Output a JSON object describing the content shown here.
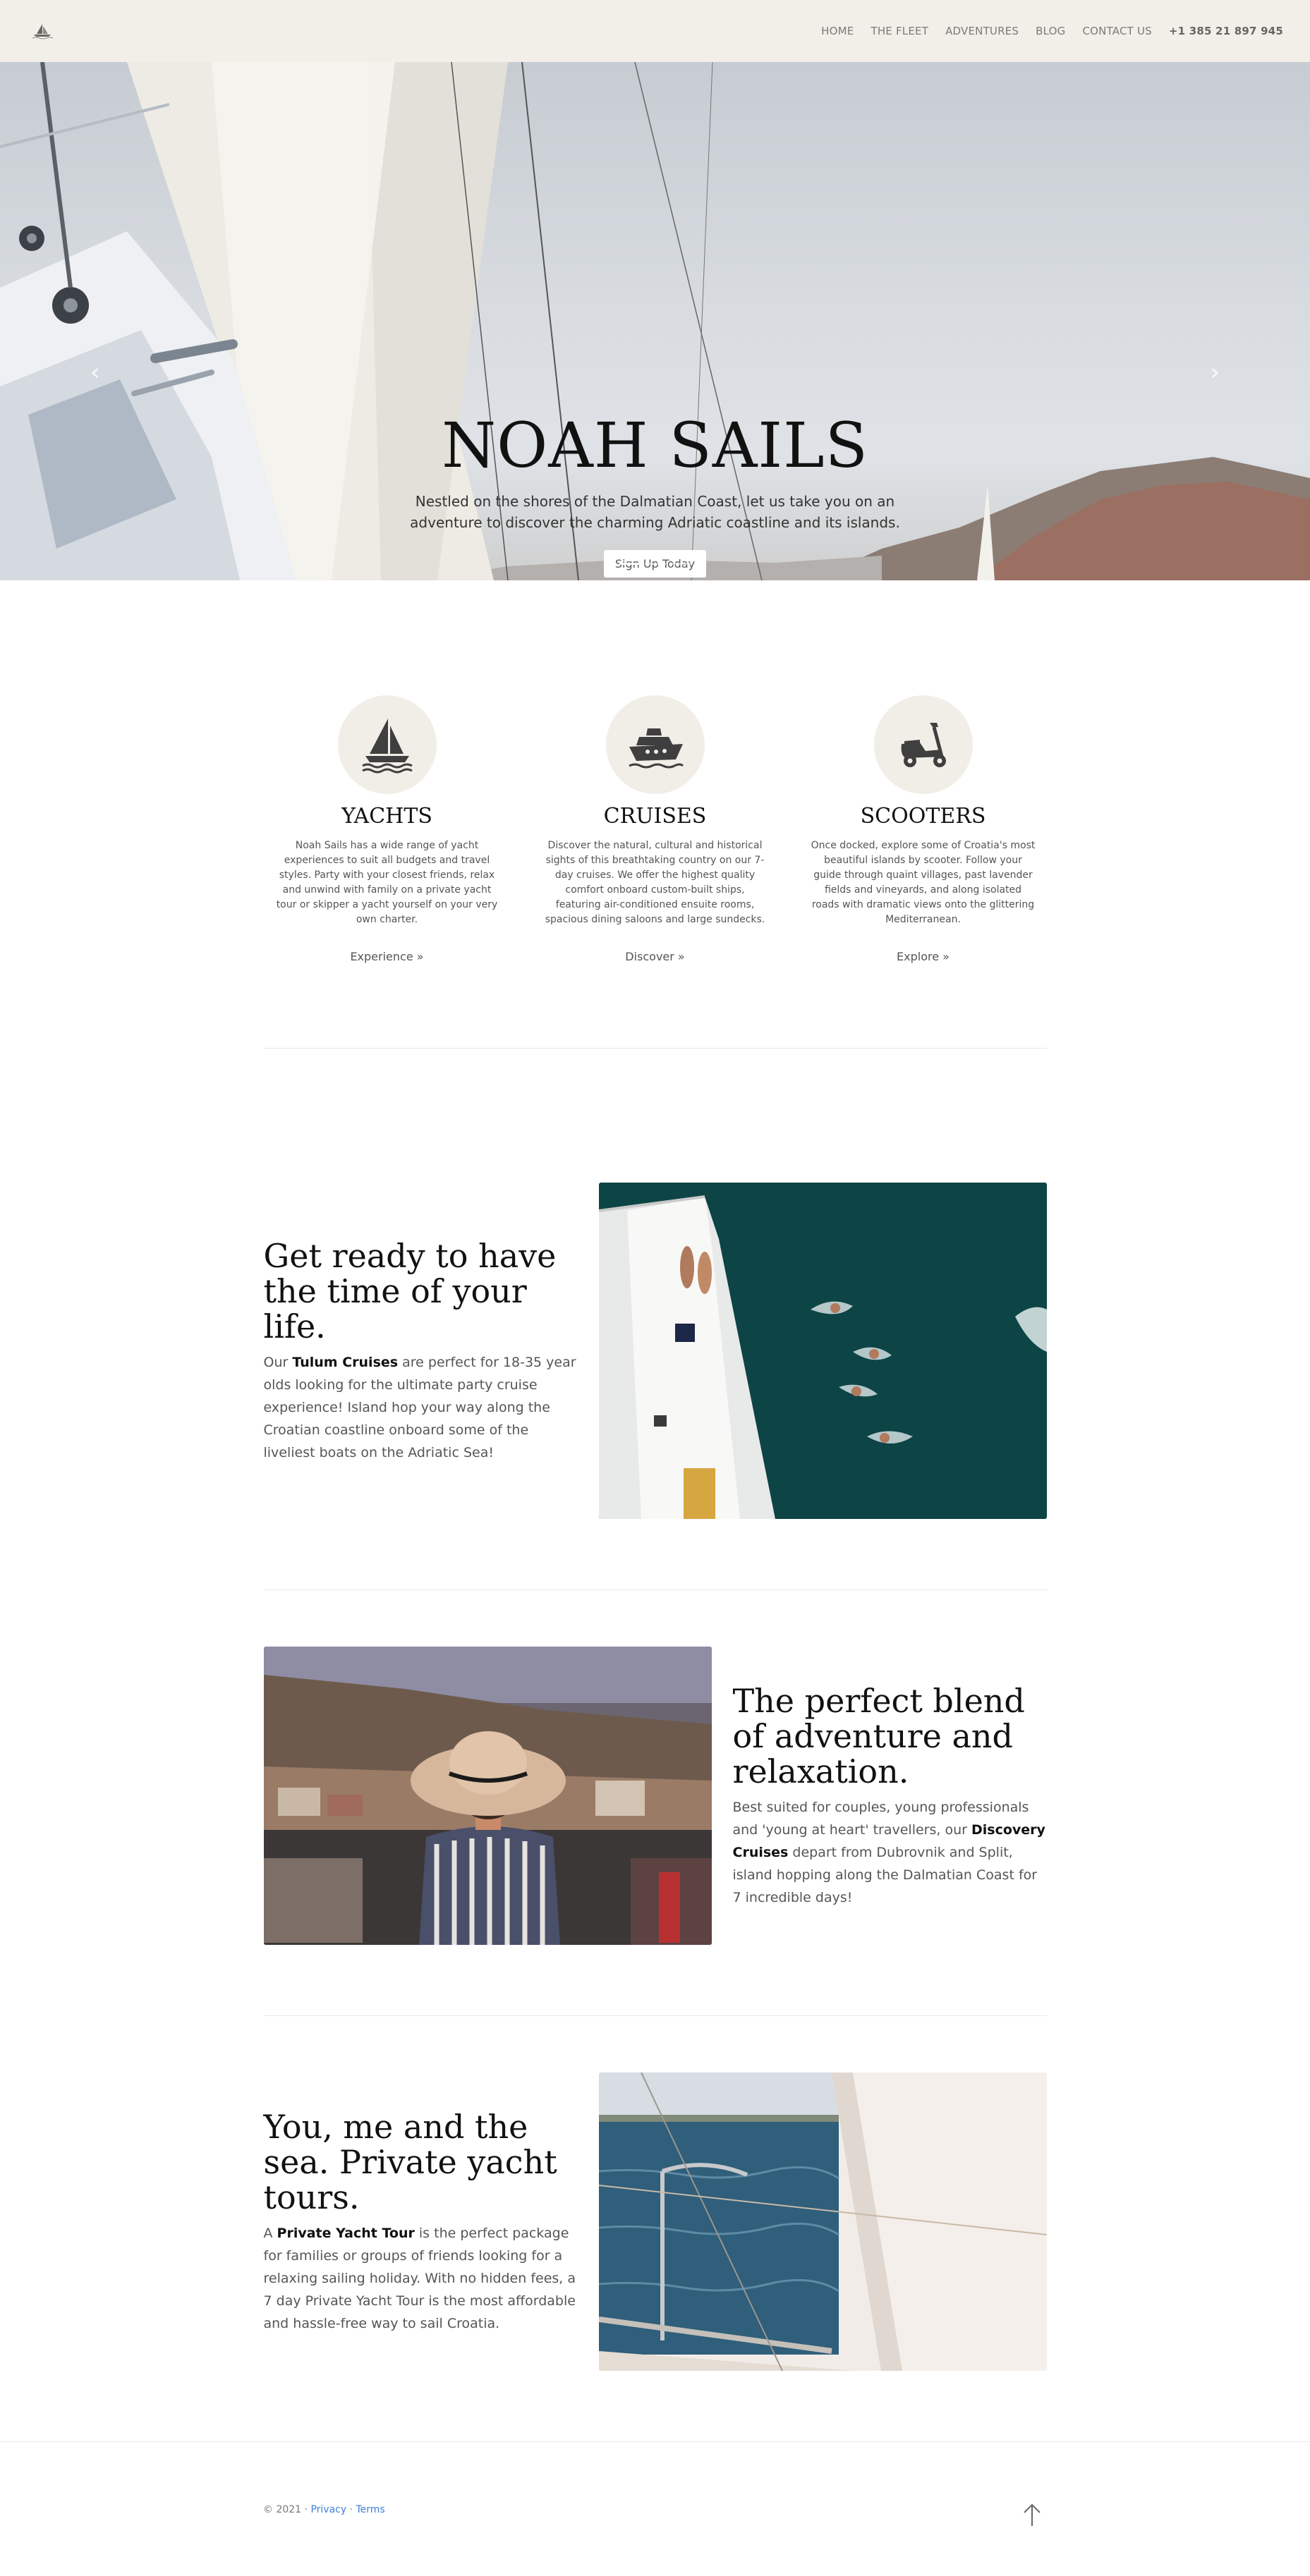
{
  "nav": {
    "logo_icon": "sailboat-logo-icon",
    "links": [
      "HOME",
      "THE FLEET",
      "ADVENTURES",
      "BLOG",
      "CONTACT US"
    ],
    "phone": "+1 385 21 897 945"
  },
  "hero": {
    "title": "NOAH SAILS",
    "subtitle": "Nestled on the shores of the Dalmatian Coast, let us take you on an adventure to discover the charming Adriatic coastline and its islands.",
    "button": "Sign Up Today",
    "prev_icon": "‹",
    "next_icon": "›"
  },
  "features": [
    {
      "icon": "sailboat-icon",
      "title": "YACHTS",
      "text": "Noah Sails has a wide range of yacht experiences to suit all budgets and travel styles. Party with your closest friends, relax and unwind with family on a private yacht tour or skipper a yacht yourself on your very own charter.",
      "link": "Experience »"
    },
    {
      "icon": "cruise-ship-icon",
      "title": "CRUISES",
      "text": "Discover the natural, cultural and historical sights of this breathtaking country on our 7-day cruises. We offer the highest quality comfort onboard custom-built ships, featuring air-conditioned ensuite rooms, spacious dining saloons and large sundecks.",
      "link": "Discover »"
    },
    {
      "icon": "scooter-icon",
      "title": "SCOOTERS",
      "text": "Once docked, explore some of Croatia's most beautiful islands by scooter. Follow your guide through quaint villages, past lavender fields and vineyards, and along isolated roads with dramatic views onto the glittering Mediterranean.",
      "link": "Explore »"
    }
  ],
  "sections": [
    {
      "heading": "Get ready to have the time of your life.",
      "p_before": "Our ",
      "p_bold": "Tulum Cruises",
      "p_after": " are perfect for 18-35 year olds looking for the ultimate party cruise experience! Island hop your way along the Croatian coastline onboard some of the liveliest boats on the Adriatic Sea!"
    },
    {
      "heading": "The perfect blend of adventure and relaxation.",
      "p_before": "Best suited for couples, young professionals and 'young at heart' travellers, our ",
      "p_bold": "Discovery Cruises",
      "p_after": " depart from Dubrovnik and Split, island hopping along the Dalmatian Coast for 7 incredible days!"
    },
    {
      "heading": "You, me and the sea. Private yacht tours.",
      "p_before": "A ",
      "p_bold": "Private Yacht Tour",
      "p_after": " is the perfect package for families or groups of friends looking for a relaxing sailing holiday. With no hidden fees, a 7 day Private Yacht Tour is the most affordable and hassle-free way to sail Croatia."
    }
  ],
  "footer": {
    "copyright": "© 2021 · ",
    "privacy": "Privacy",
    "sep": " · ",
    "terms": "Terms",
    "up_icon": "arrow-up-icon"
  }
}
